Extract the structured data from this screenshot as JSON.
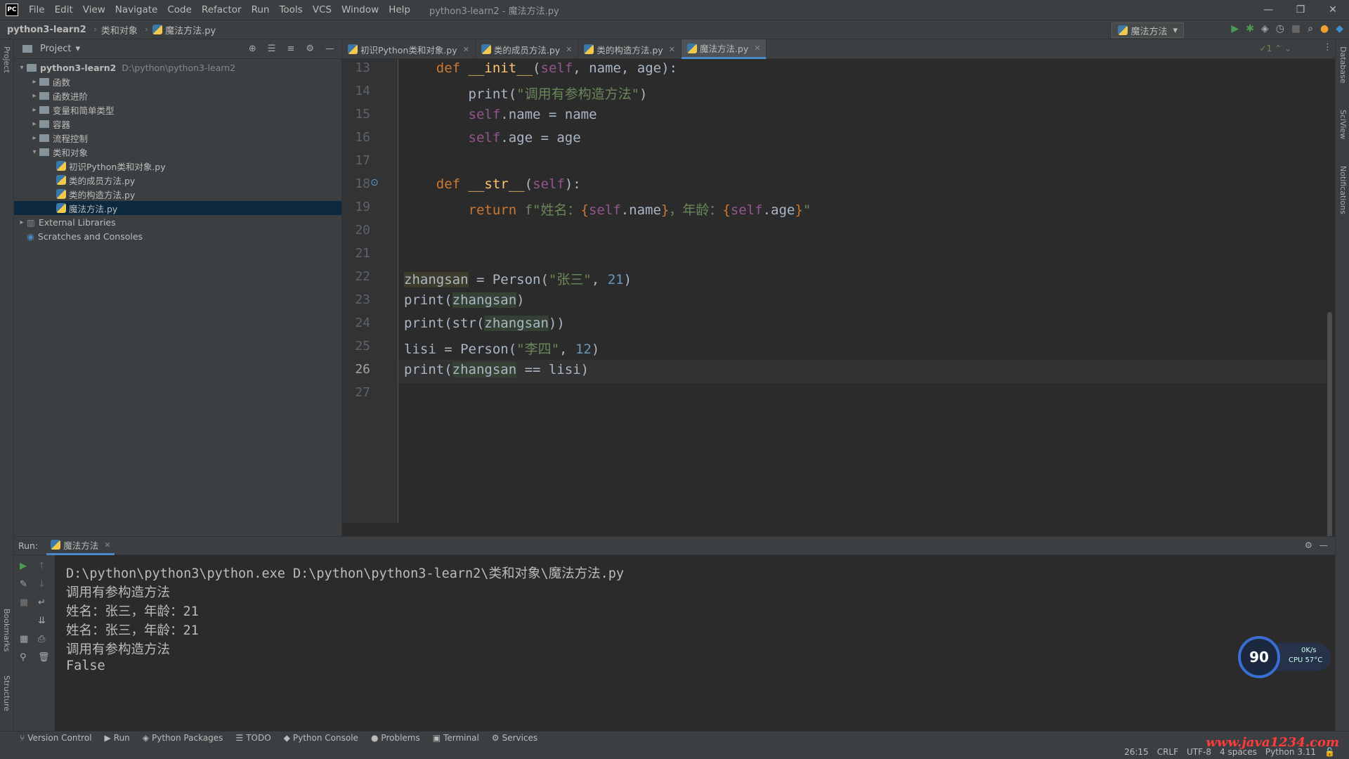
{
  "app": {
    "logo": "PC",
    "menu": [
      "File",
      "Edit",
      "View",
      "Navigate",
      "Code",
      "Refactor",
      "Run",
      "Tools",
      "VCS",
      "Window",
      "Help"
    ],
    "window_title": "python3-learn2 - 魔法方法.py"
  },
  "nav": {
    "breadcrumb": [
      "python3-learn2",
      "类和对象",
      "魔法方法.py"
    ],
    "run_config": "魔法方法"
  },
  "project": {
    "title": "Project",
    "root": "python3-learn2",
    "root_path": "D:\\python\\python3-learn2",
    "folders": [
      "函数",
      "函数进阶",
      "变量和简单类型",
      "容器",
      "流程控制",
      "类和对象"
    ],
    "files": [
      "初识Python类和对象.py",
      "类的成员方法.py",
      "类的构造方法.py",
      "魔法方法.py"
    ],
    "external": "External Libraries",
    "scratches": "Scratches and Consoles"
  },
  "tabs": [
    "初识Python类和对象.py",
    "类的成员方法.py",
    "类的构造方法.py",
    "魔法方法.py"
  ],
  "editor": {
    "line_numbers": [
      "13",
      "14",
      "15",
      "16",
      "17",
      "18",
      "19",
      "20",
      "21",
      "22",
      "23",
      "24",
      "25",
      "26",
      "27"
    ],
    "inspection": "1"
  },
  "run": {
    "label": "Run:",
    "tab": "魔法方法",
    "output": [
      "D:\\python\\python3\\python.exe D:\\python\\python3-learn2\\类和对象\\魔法方法.py",
      "调用有参构造方法",
      "姓名：张三，年龄：21",
      "姓名：张三，年龄：21",
      "调用有参构造方法",
      "False"
    ]
  },
  "statusbar": {
    "tabs": [
      "Version Control",
      "Run",
      "Python Packages",
      "TODO",
      "Python Console",
      "Problems",
      "Terminal",
      "Services"
    ],
    "position": "26:15",
    "line_sep": "CRLF",
    "encoding": "UTF-8",
    "indent": "4 spaces",
    "interpreter": "Python 3.11"
  },
  "widget": {
    "value": "90",
    "net": "0K/s",
    "cpu": "CPU 57°C"
  },
  "side_labels": {
    "left_top": "Project",
    "left_mid": "Bookmarks",
    "left_bot": "Structure",
    "right1": "Database",
    "right2": "SciView",
    "right3": "Notifications"
  },
  "watermark": "www.java1234.com"
}
